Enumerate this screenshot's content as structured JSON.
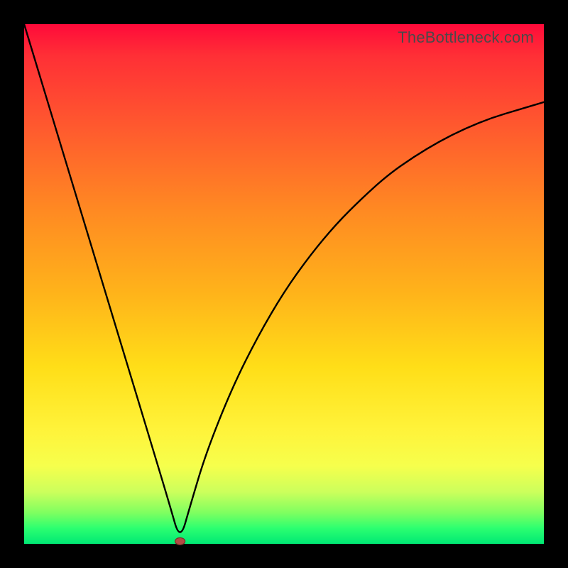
{
  "watermark": {
    "text": "TheBottleneck.com"
  },
  "colors": {
    "frame": "#000000",
    "curve": "#000000",
    "marker_fill": "#b24a44",
    "marker_stroke": "#7a2d27"
  },
  "chart_data": {
    "type": "line",
    "title": "",
    "xlabel": "",
    "ylabel": "",
    "xlim": [
      0,
      1
    ],
    "ylim": [
      0,
      1
    ],
    "grid": false,
    "x": [
      0.0,
      0.05,
      0.1,
      0.15,
      0.2,
      0.25,
      0.28,
      0.3,
      0.32,
      0.35,
      0.4,
      0.45,
      0.5,
      0.55,
      0.6,
      0.65,
      0.7,
      0.75,
      0.8,
      0.85,
      0.9,
      0.95,
      1.0
    ],
    "values": [
      1.0,
      0.835,
      0.67,
      0.505,
      0.34,
      0.175,
      0.075,
      0.005,
      0.075,
      0.175,
      0.3,
      0.4,
      0.485,
      0.555,
      0.615,
      0.665,
      0.71,
      0.745,
      0.775,
      0.8,
      0.82,
      0.835,
      0.85
    ],
    "marker": {
      "x": 0.3,
      "y": 0.005
    },
    "notes": "Values are high near the edges and dip to a minimum near x≈0.30; left branch looks roughly linear, right branch rises with diminishing slope. Axes are unlabeled in the source image; x and y are normalized 0–1 estimates read off the plot area."
  }
}
